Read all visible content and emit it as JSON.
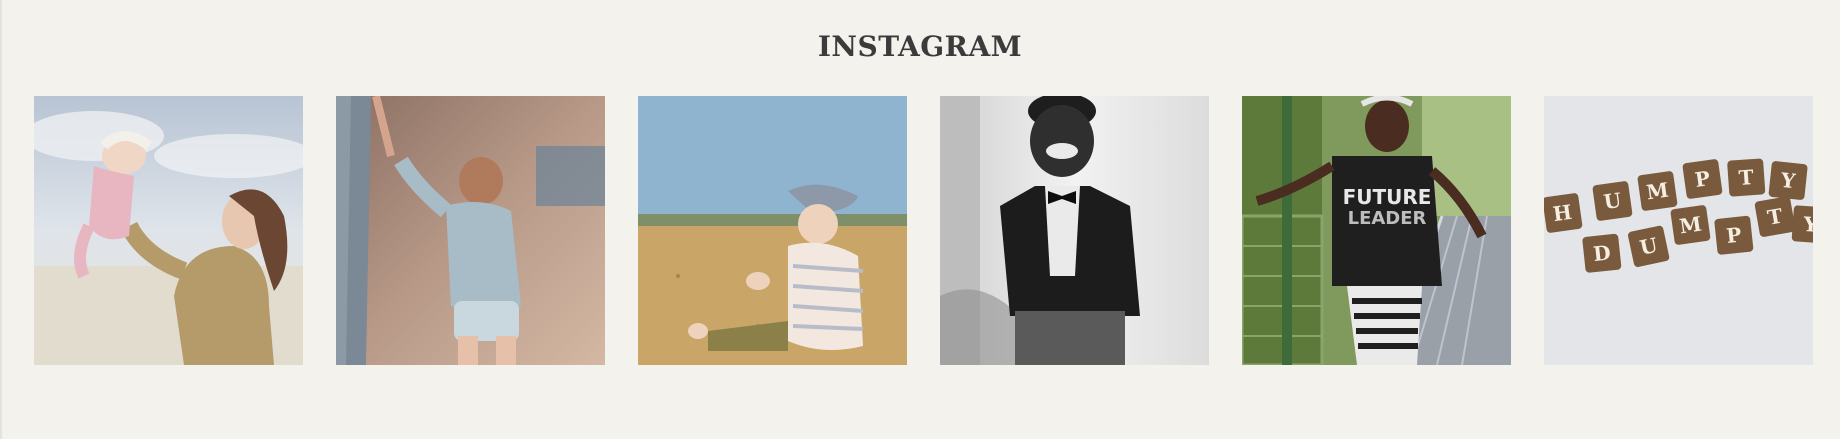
{
  "section": {
    "title": "INSTAGRAM"
  },
  "gallery": {
    "photos": [
      {
        "subject": "mother lifting baby at the beach",
        "icon": "photo-icon"
      },
      {
        "subject": "toddler holding parent's hand outdoors",
        "icon": "photo-icon"
      },
      {
        "subject": "baby sitting on sand under blue sky",
        "icon": "photo-icon"
      },
      {
        "subject": "smiling boy in bow tie, black and white",
        "icon": "photo-icon"
      },
      {
        "subject": "girl in FUTURE LEADER shirt on bridge",
        "icon": "photo-icon"
      },
      {
        "subject": "scrabble tiles spelling HUMPTY DUMPTY",
        "icon": "photo-icon"
      }
    ],
    "shirt_text": [
      "FUTURE",
      "LEADER"
    ],
    "tiles_row1": [
      "H",
      "U",
      "M",
      "P",
      "T",
      "Y"
    ],
    "tiles_row2": [
      "D",
      "U",
      "M",
      "P",
      "T",
      "Y"
    ]
  },
  "colors": {
    "background": "#f3f2ec",
    "title": "#3b3b3b",
    "tile_wood": "#7a5a3c"
  }
}
